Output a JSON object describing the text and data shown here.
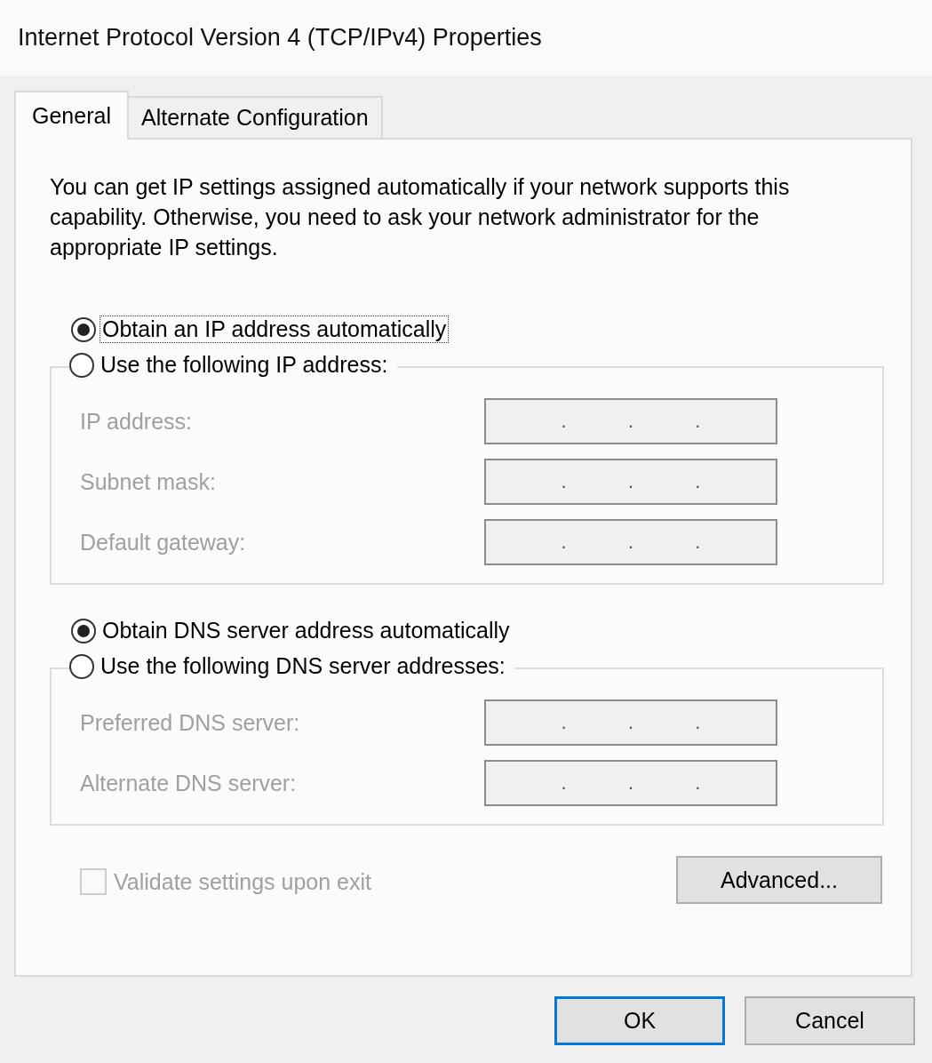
{
  "window": {
    "title": "Internet Protocol Version 4 (TCP/IPv4) Properties"
  },
  "tabs": [
    {
      "label": "General",
      "selected": true
    },
    {
      "label": "Alternate Configuration",
      "selected": false
    }
  ],
  "description": "You can get IP settings assigned automatically if your network supports this capability. Otherwise, you need to ask your network administrator for the appropriate IP settings.",
  "ip_section": {
    "options": [
      {
        "label": "Obtain an IP address automatically",
        "selected": true,
        "focused": true
      },
      {
        "label": "Use the following IP address:",
        "selected": false,
        "focused": false
      }
    ],
    "fields": [
      {
        "label": "IP address:",
        "disabled": true,
        "separators": [
          ".",
          ".",
          "."
        ]
      },
      {
        "label": "Subnet mask:",
        "disabled": true,
        "separators": [
          ".",
          ".",
          "."
        ]
      },
      {
        "label": "Default gateway:",
        "disabled": true,
        "separators": [
          ".",
          ".",
          "."
        ]
      }
    ]
  },
  "dns_section": {
    "options": [
      {
        "label": "Obtain DNS server address automatically",
        "selected": true,
        "focused": false
      },
      {
        "label": "Use the following DNS server addresses:",
        "selected": false,
        "focused": false
      }
    ],
    "fields": [
      {
        "label": "Preferred DNS server:",
        "disabled": true,
        "separators": [
          ".",
          ".",
          "."
        ]
      },
      {
        "label": "Alternate DNS server:",
        "disabled": true,
        "separators": [
          ".",
          ".",
          "."
        ]
      }
    ]
  },
  "validate_checkbox": {
    "label": "Validate settings upon exit",
    "checked": false,
    "disabled": true
  },
  "advanced_button": {
    "label": "Advanced..."
  },
  "buttons": [
    {
      "label": "OK",
      "default": true
    },
    {
      "label": "Cancel",
      "default": false
    }
  ]
}
